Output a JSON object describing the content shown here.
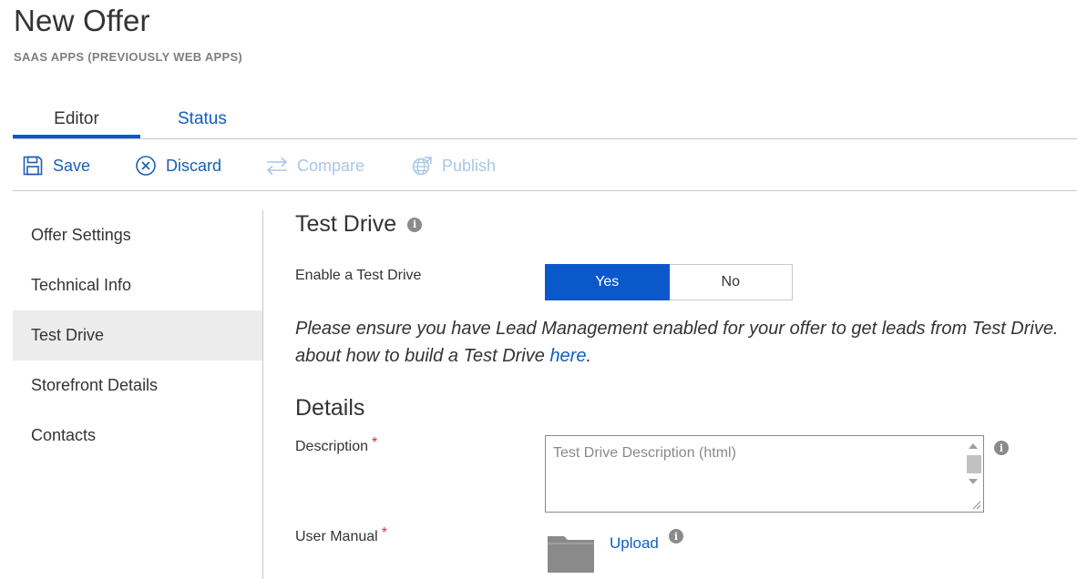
{
  "header": {
    "title": "New Offer",
    "subtitle": "SAAS APPS (PREVIOUSLY WEB APPS)"
  },
  "tabs": [
    {
      "label": "Editor",
      "active": true
    },
    {
      "label": "Status",
      "active": false
    }
  ],
  "toolbar": {
    "save": {
      "label": "Save",
      "icon": "save-icon",
      "enabled": true
    },
    "discard": {
      "label": "Discard",
      "icon": "discard-icon",
      "enabled": true
    },
    "compare": {
      "label": "Compare",
      "icon": "compare-icon",
      "enabled": false
    },
    "publish": {
      "label": "Publish",
      "icon": "publish-icon",
      "enabled": false
    }
  },
  "sidebar": {
    "items": [
      {
        "label": "Offer Settings",
        "active": false
      },
      {
        "label": "Technical Info",
        "active": false
      },
      {
        "label": "Test Drive",
        "active": true
      },
      {
        "label": "Storefront Details",
        "active": false
      },
      {
        "label": "Contacts",
        "active": false
      }
    ]
  },
  "main": {
    "section_title": "Test Drive",
    "enable_label": "Enable a Test Drive",
    "toggle": {
      "yes": "Yes",
      "no": "No",
      "selected": "Yes"
    },
    "notice_line1": "Please ensure you have Lead Management enabled for your offer to get leads from Test Drive.",
    "notice_line2_prefix": "about how to build a Test Drive ",
    "notice_link": "here",
    "notice_line2_suffix": ".",
    "details_title": "Details",
    "description": {
      "label": "Description",
      "required_mark": "*",
      "placeholder": "Test Drive Description (html)",
      "value": ""
    },
    "user_manual": {
      "label": "User Manual",
      "required_mark": "*",
      "upload_label": "Upload"
    },
    "info_icon_glyph": "i"
  },
  "colors": {
    "accent": "#0a58ca",
    "link": "#0f5ec0",
    "disabled": "#a9c5e8",
    "required": "#d13438",
    "active_nav_bg": "#ececec"
  }
}
